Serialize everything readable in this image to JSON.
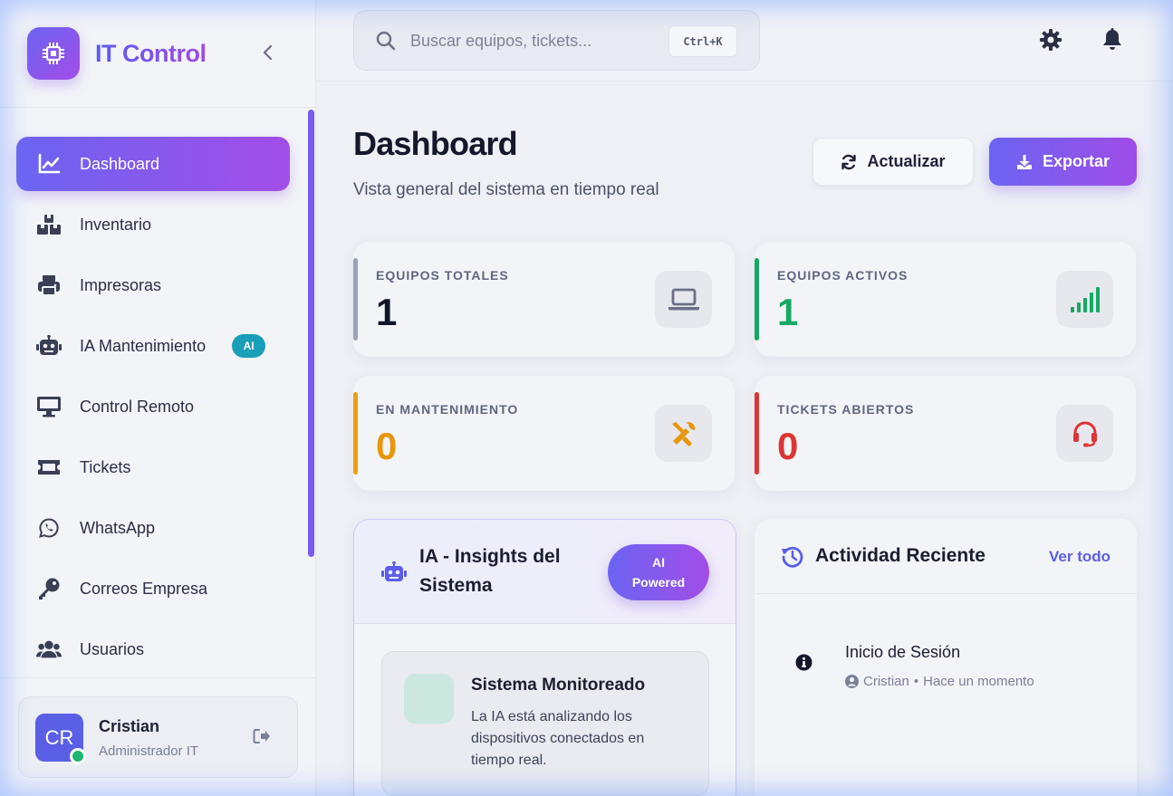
{
  "brand": {
    "title": "IT Control"
  },
  "sidebar": {
    "items": [
      {
        "label": "Dashboard",
        "icon": "chart-line-icon",
        "active": true
      },
      {
        "label": "Inventario",
        "icon": "boxes-icon"
      },
      {
        "label": "Impresoras",
        "icon": "printer-icon"
      },
      {
        "label": "IA Mantenimiento",
        "icon": "robot-icon",
        "badge": "AI"
      },
      {
        "label": "Control Remoto",
        "icon": "desktop-icon"
      },
      {
        "label": "Tickets",
        "icon": "ticket-icon"
      },
      {
        "label": "WhatsApp",
        "icon": "whatsapp-icon"
      },
      {
        "label": "Correos Empresa",
        "icon": "key-icon"
      },
      {
        "label": "Usuarios",
        "icon": "users-icon"
      }
    ]
  },
  "user": {
    "initials": "CR",
    "name": "Cristian",
    "role": "Administrador IT"
  },
  "search": {
    "placeholder": "Buscar equipos, tickets...",
    "shortcut": "Ctrl+K"
  },
  "header": {
    "title": "Dashboard",
    "subtitle": "Vista general del sistema en tiempo real",
    "refresh_label": "Actualizar",
    "export_label": "Exportar"
  },
  "stats": [
    {
      "label": "EQUIPOS TOTALES",
      "value": "1",
      "color": "#11162a",
      "accent": "#9aa3b8",
      "icon": "laptop-icon"
    },
    {
      "label": "EQUIPOS ACTIVOS",
      "value": "1",
      "color": "#17a964",
      "accent": "#17a964",
      "icon": "signal-icon"
    },
    {
      "label": "EN MANTENIMIENTO",
      "value": "0",
      "color": "#e8960c",
      "accent": "#eba010",
      "icon": "tools-icon"
    },
    {
      "label": "TICKETS ABIERTOS",
      "value": "0",
      "color": "#dd3535",
      "accent": "#dd3535",
      "icon": "headset-icon"
    }
  ],
  "ai_panel": {
    "title_line1": "IA - Insights del",
    "title_line2": "Sistema",
    "badge_line1": "AI",
    "badge_line2": "Powered",
    "insight_title": "Sistema Monitoreado",
    "insight_text": "La IA está analizando los dispositivos conectados en tiempo real."
  },
  "activity": {
    "title": "Actividad Reciente",
    "see_all": "Ver todo",
    "items": [
      {
        "title": "Inicio de Sesión",
        "user": "Cristian",
        "time": "Hace un momento"
      }
    ],
    "separator": "•"
  }
}
